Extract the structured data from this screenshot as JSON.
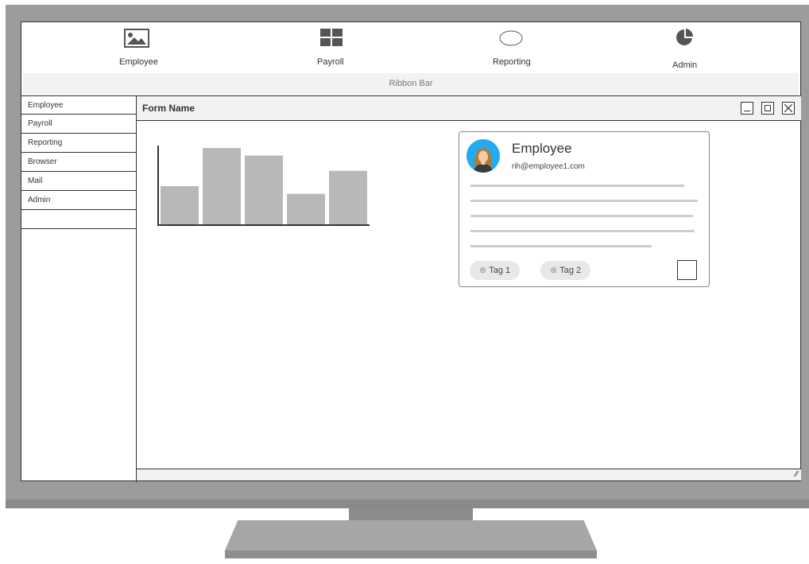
{
  "nav": {
    "items": [
      {
        "label": "Employee",
        "icon": "image-icon"
      },
      {
        "label": "Payroll",
        "icon": "grid-icon"
      },
      {
        "label": "Reporting",
        "icon": "circle-icon"
      },
      {
        "label": "Admin",
        "icon": "pie-chart-icon"
      }
    ]
  },
  "ribbon": {
    "label": "Ribbon Bar"
  },
  "sidebar": {
    "items": [
      "Employee",
      "Payroll",
      "Reporting",
      "Browser",
      "Mail",
      "Admin"
    ]
  },
  "window": {
    "title": "Form Name"
  },
  "chart_data": {
    "type": "bar",
    "categories": [
      "",
      "",
      "",
      "",
      ""
    ],
    "values": [
      50,
      100,
      90,
      40,
      70
    ],
    "title": "",
    "xlabel": "",
    "ylabel": "",
    "ylim": [
      0,
      100
    ],
    "color": "#b8b8b8"
  },
  "card": {
    "name": "Employee",
    "email": "rih@employee1.com",
    "tags": [
      "Tag 1",
      "Tag 2"
    ],
    "avatar_color": "#23aaf2"
  },
  "colors": {
    "frame": "#9c9c9c",
    "panel": "#f2f2f2",
    "border": "#333333"
  }
}
